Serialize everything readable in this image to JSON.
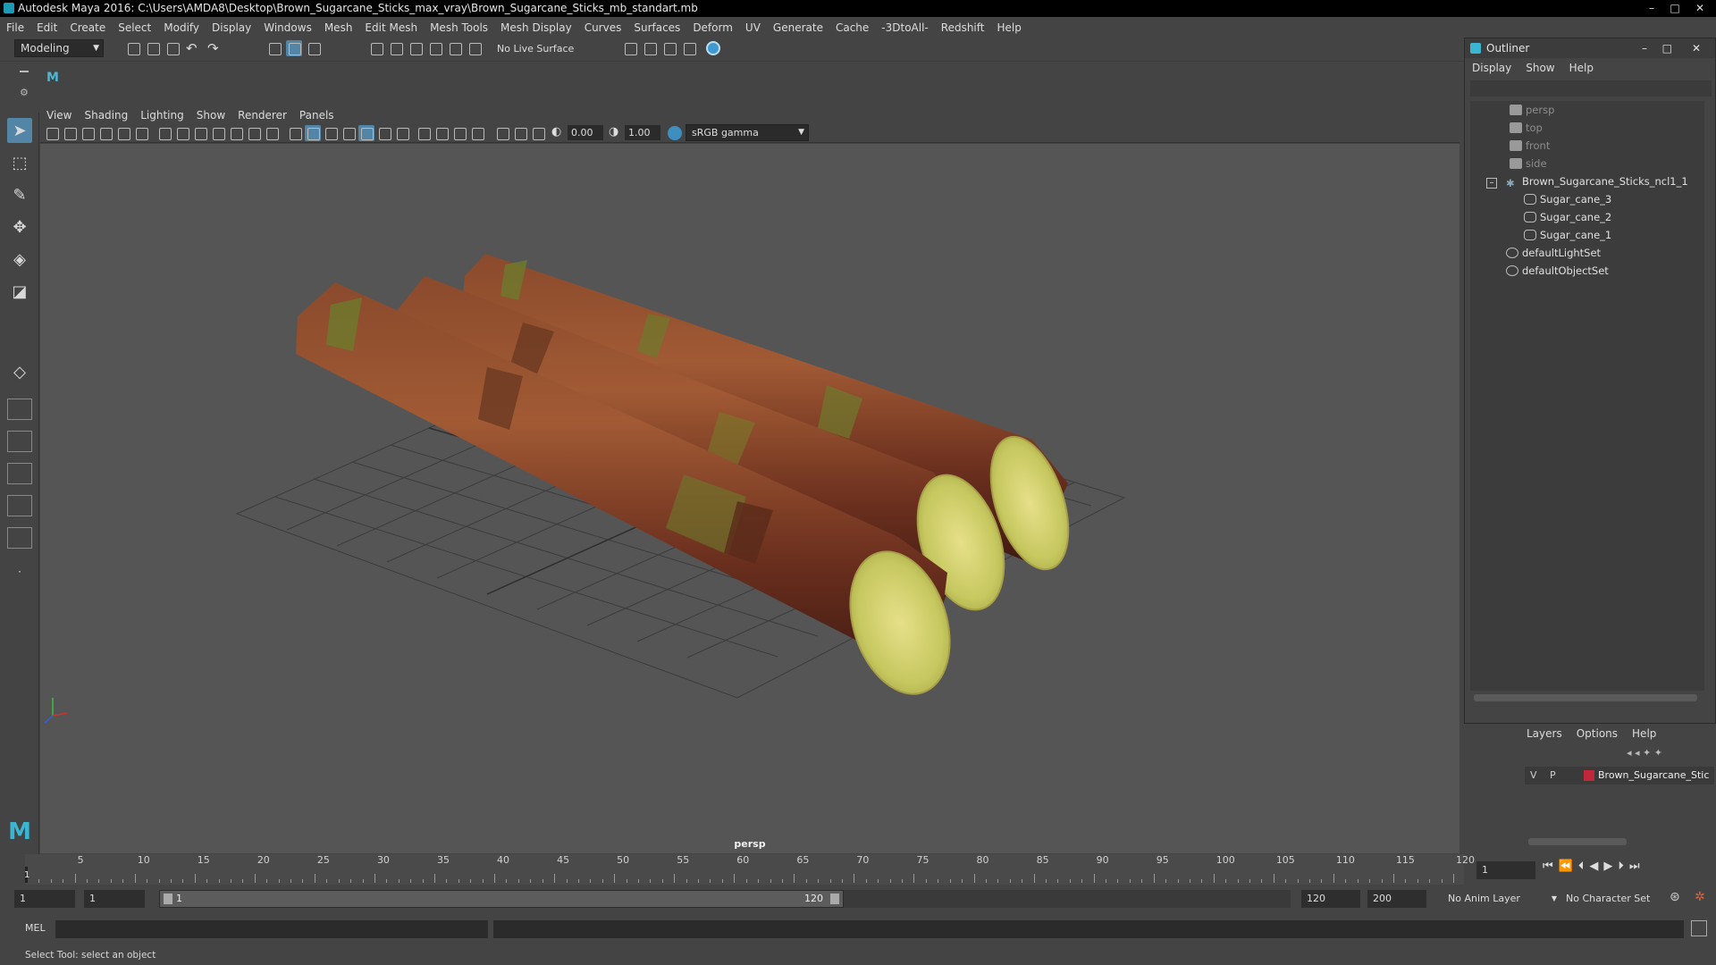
{
  "window": {
    "title": "Autodesk Maya 2016: C:\\Users\\AMDA8\\Desktop\\Brown_Sugarcane_Sticks_max_vray\\Brown_Sugarcane_Sticks_mb_standart.mb"
  },
  "menubar": [
    "File",
    "Edit",
    "Create",
    "Select",
    "Modify",
    "Display",
    "Windows",
    "Mesh",
    "Edit Mesh",
    "Mesh Tools",
    "Mesh Display",
    "Curves",
    "Surfaces",
    "Deform",
    "UV",
    "Generate",
    "Cache",
    "-3DtoAll-",
    "Redshift",
    "Help"
  ],
  "statusline": {
    "mode": "Modeling",
    "live_surface": "No Live Surface"
  },
  "panel": {
    "menus": [
      "View",
      "Shading",
      "Lighting",
      "Show",
      "Renderer",
      "Panels"
    ],
    "exposure": "0.00",
    "gamma": "1.00",
    "color_space": "sRGB gamma",
    "camera_label": "persp"
  },
  "outliner": {
    "title": "Outliner",
    "menus": [
      "Display",
      "Show",
      "Help"
    ],
    "items": [
      {
        "label": "persp",
        "type": "camera"
      },
      {
        "label": "top",
        "type": "camera"
      },
      {
        "label": "front",
        "type": "camera"
      },
      {
        "label": "side",
        "type": "camera"
      },
      {
        "label": "Brown_Sugarcane_Sticks_ncl1_1",
        "type": "group"
      },
      {
        "label": "Sugar_cane_3",
        "type": "mesh"
      },
      {
        "label": "Sugar_cane_2",
        "type": "mesh"
      },
      {
        "label": "Sugar_cane_1",
        "type": "mesh"
      },
      {
        "label": "defaultLightSet",
        "type": "set"
      },
      {
        "label": "defaultObjectSet",
        "type": "set"
      }
    ]
  },
  "layers": {
    "menus": [
      "Layers",
      "Options",
      "Help"
    ],
    "row": {
      "v": "V",
      "p": "P",
      "name": "Brown_Sugarcane_Stic",
      "color": "#c0283a"
    }
  },
  "timeline": {
    "ticks": [
      "5",
      "10",
      "15",
      "20",
      "25",
      "30",
      "35",
      "40",
      "45",
      "50",
      "55",
      "60",
      "65",
      "70",
      "75",
      "80",
      "85",
      "90",
      "95",
      "100",
      "105",
      "110",
      "115",
      "120"
    ],
    "current_frame_label": "1",
    "current_frame": "1"
  },
  "range": {
    "start": "1",
    "playback_start": "1",
    "slider_start": "1",
    "slider_end": "120",
    "playback_end": "120",
    "end": "200",
    "anim_layer": "No Anim Layer",
    "character_set": "No Character Set"
  },
  "cmdline": {
    "label": "MEL"
  },
  "helpline": {
    "text": "Select Tool: select an object"
  },
  "colors": {
    "accent": "#5285a6",
    "viewport_bg": "#555555",
    "layer_color": "#c0283a"
  }
}
